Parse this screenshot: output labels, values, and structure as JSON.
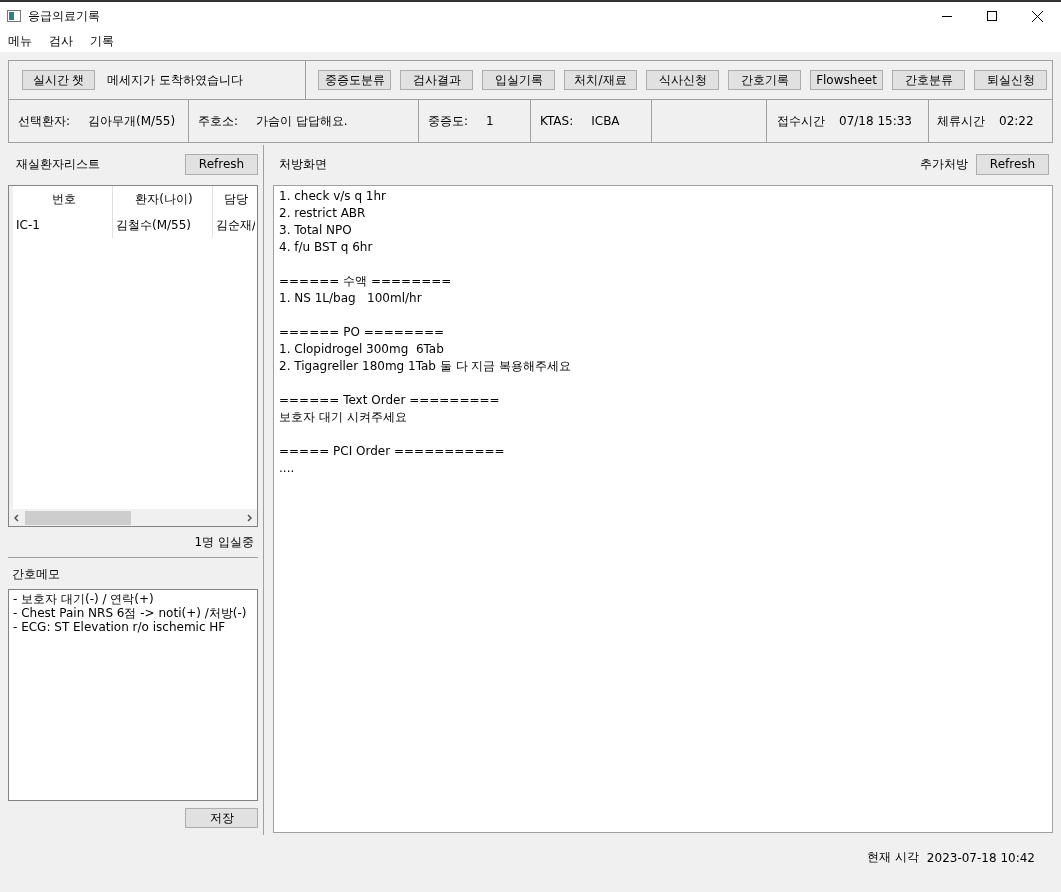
{
  "window": {
    "title": "응급의료기록"
  },
  "menu": [
    {
      "label": "메뉴"
    },
    {
      "label": "검사"
    },
    {
      "label": "기록"
    }
  ],
  "chat": {
    "button": "실시간 챗",
    "message": "메세지가 도착하였습니다"
  },
  "toolbar": [
    "중증도분류",
    "검사결과",
    "입실기록",
    "처치/재료",
    "식사신청",
    "간호기록",
    "Flowsheet",
    "간호분류",
    "퇴실신청"
  ],
  "patient_info": [
    {
      "label": "선택환자:",
      "value": "김아무개(M/55)"
    },
    {
      "label": "주호소:",
      "value": "가슴이 답답해요."
    },
    {
      "label": "중증도:",
      "value": "1"
    },
    {
      "label": "KTAS:",
      "value": "ICBA"
    },
    {
      "label": "접수시간",
      "value": "07/18 15:33"
    },
    {
      "label": "체류시간",
      "value": "02:22"
    }
  ],
  "patient_list": {
    "title": "재실환자리스트",
    "refresh": "Refresh",
    "columns": [
      "번호",
      "환자(나이)",
      "담당"
    ],
    "rows": [
      [
        "IC-1",
        "김철수(M/55)",
        "김순재/"
      ]
    ],
    "count": "1명 입실중"
  },
  "nurse_memo": {
    "title": "간호메모",
    "lines": [
      "- 보호자 대기(-) / 연락(+)",
      "- Chest Pain NRS 6점 -> noti(+) /처방(-)",
      "- ECG: ST Elevation r/o ischemic HF"
    ],
    "save": "저장"
  },
  "prescription": {
    "title": "처방화면",
    "extra": "추가처방",
    "refresh": "Refresh",
    "groups": [
      [
        "1. check v/s q 1hr",
        "2. restrict ABR",
        "3. Total NPO",
        "4. f/u BST q 6hr"
      ],
      [
        "====== 수액 ========",
        "1. NS 1L/bag   100ml/hr"
      ],
      [
        "====== PO ========",
        "1. Clopidrogel 300mg  6Tab",
        "2. Tigagreller 180mg 1Tab 둘 다 지금 복용해주세요"
      ],
      [
        "====== Text Order =========",
        "보호자 대기 시켜주세요"
      ],
      [
        "===== PCI Order ===========",
        "...."
      ]
    ]
  },
  "status_bar": {
    "label": "현재 시각",
    "time": "2023-07-18 10:42"
  }
}
